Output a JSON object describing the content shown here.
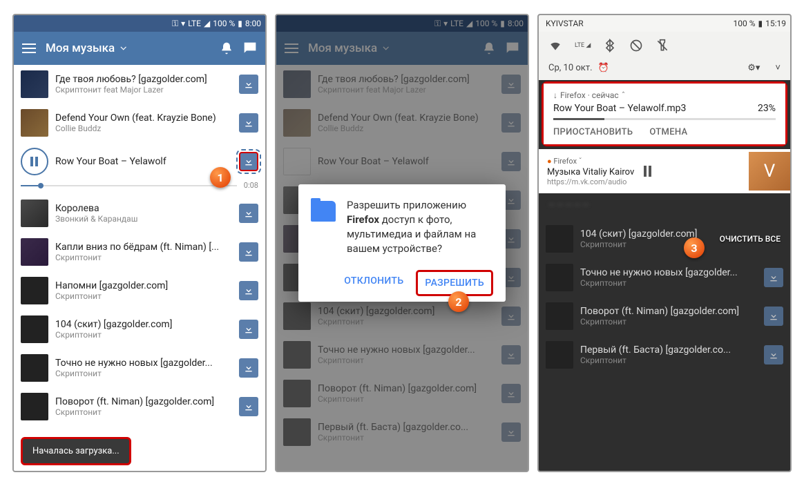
{
  "statusbar": {
    "battery": "100 %",
    "time": "8:00",
    "lte": "LTE"
  },
  "statusbar3": {
    "carrier": "KYIVSTAR",
    "battery": "100 %",
    "time": "15:19"
  },
  "appbar": {
    "title": "Моя музыка"
  },
  "tracks": [
    {
      "title": "Где твоя любовь? [gazgolder.com]",
      "artist": "Скриптонит feat Major Lazer"
    },
    {
      "title": "Defend Your Own (feat. Krayzie Bone)",
      "artist": "Collie Buddz"
    },
    {
      "title": "Row Your Boat – Yelawolf",
      "artist": "",
      "time": "0:08"
    },
    {
      "title": "Королева",
      "artist": "Звонкий & Карандаш"
    },
    {
      "title": "Капли вниз по бёдрам (ft. Niman) [...",
      "artist": "Скриптонит"
    },
    {
      "title": "Напомни [gazgolder.com]",
      "artist": "Скриптонит"
    },
    {
      "title": "104 (скит) [gazgolder.com]",
      "artist": "Скриптонит"
    },
    {
      "title": "Точно не нужно новых [gazgolder...",
      "artist": "Скриптонит"
    },
    {
      "title": "Поворот (ft. Niman) [gazgolder.com]",
      "artist": "Скриптонит"
    },
    {
      "title": "Первый (ft. Баста) [gazgolder.co...",
      "artist": "Скриптонит"
    }
  ],
  "toast": "Началась загрузка...",
  "dialog": {
    "text_pre": "Разрешить приложению ",
    "text_app": "Firefox",
    "text_post": " доступ к фото, мультимедиа и файлам на вашем устройстве?",
    "deny": "ОТКЛОНИТЬ",
    "allow": "РАЗРЕШИТЬ"
  },
  "qs": {
    "date": "Ср, 10 окт."
  },
  "notif": {
    "head": "Firefox · сейчас",
    "file": "Row Your Boat – Yelawolf.mp3",
    "percent": "23%",
    "pause": "ПРИОСТАНОВИТЬ",
    "cancel": "ОТМЕНА"
  },
  "ffcard": {
    "head": "Firefox",
    "chev": "ˇ",
    "title": "Музыка Vitaliy Kairov",
    "sub": "https://m.vk.com/audio",
    "letter": "V"
  },
  "clearall": "ОЧИСТИТЬ ВСЕ",
  "callouts": {
    "c1": "1",
    "c2": "2",
    "c3": "3"
  }
}
